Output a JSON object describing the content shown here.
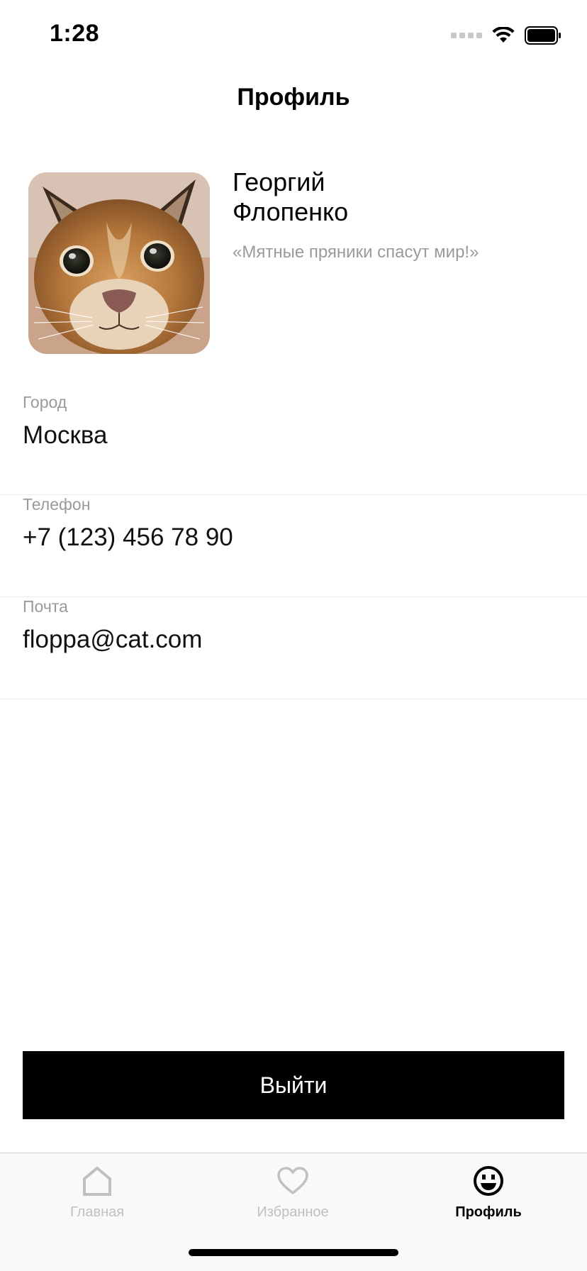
{
  "status_bar": {
    "time": "1:28"
  },
  "header": {
    "title": "Профиль"
  },
  "profile": {
    "first_name": "Георгий",
    "last_name": "Флопенко",
    "quote": "«Мятные пряники спасут мир!»",
    "avatar_icon": "caracal-cat-photo"
  },
  "info": [
    {
      "label": "Город",
      "value": "Москва"
    },
    {
      "label": "Телефон",
      "value": "+7 (123) 456 78 90"
    },
    {
      "label": "Почта",
      "value": "floppa@cat.com"
    }
  ],
  "logout": {
    "label": "Выйти"
  },
  "tab_bar": {
    "items": [
      {
        "label": "Главная",
        "icon": "home-icon",
        "active": false
      },
      {
        "label": "Избранное",
        "icon": "heart-icon",
        "active": false
      },
      {
        "label": "Профиль",
        "icon": "smiley-icon",
        "active": true
      }
    ]
  },
  "colors": {
    "accent": "#000000",
    "muted_text": "#9a9a9a",
    "inactive_tab": "#c0c0c0",
    "tab_bar_bg": "#f9f9f9"
  }
}
